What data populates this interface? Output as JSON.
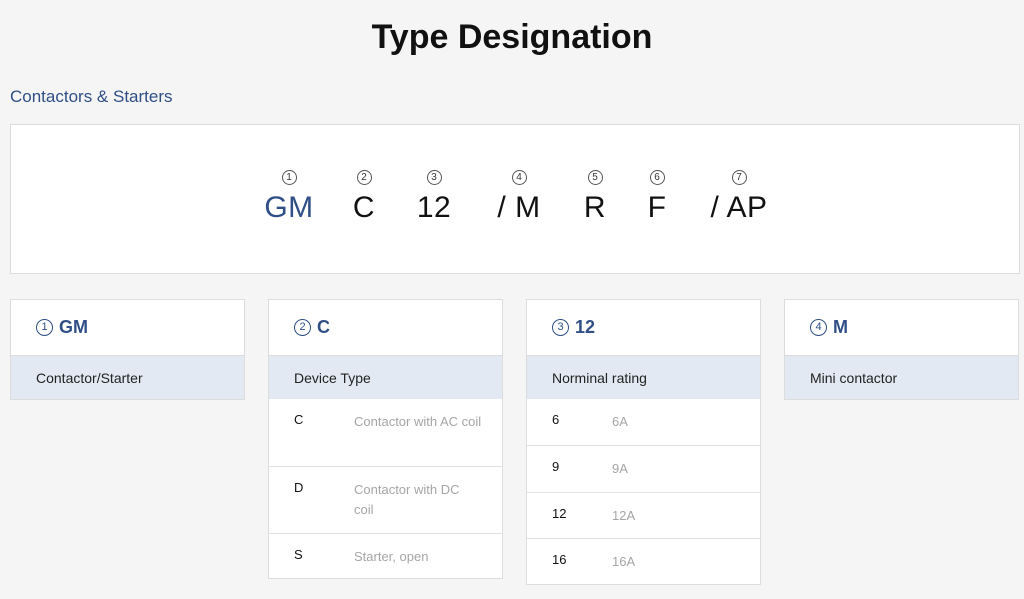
{
  "page": {
    "title": "Type Designation",
    "section": "Contactors & Starters"
  },
  "designation": [
    {
      "num": "1",
      "code": "GM"
    },
    {
      "num": "2",
      "code": "C"
    },
    {
      "num": "3",
      "code": "12"
    },
    {
      "num": "4",
      "code": "/ M"
    },
    {
      "num": "5",
      "code": "R"
    },
    {
      "num": "6",
      "code": "F"
    },
    {
      "num": "7",
      "code": "/ AP"
    }
  ],
  "cards": [
    {
      "num": "1",
      "code": "GM",
      "subtitle": "Contactor/Starter",
      "options": []
    },
    {
      "num": "2",
      "code": "C",
      "subtitle": "Device Type",
      "options": [
        {
          "code": "C",
          "desc": "Contactor with AC coil"
        },
        {
          "code": "D",
          "desc": "Contactor with DC coil"
        },
        {
          "code": "S",
          "desc": "Starter, open"
        }
      ]
    },
    {
      "num": "3",
      "code": "12",
      "subtitle": "Norminal rating",
      "options": [
        {
          "code": "6",
          "desc": "6A"
        },
        {
          "code": "9",
          "desc": "9A"
        },
        {
          "code": "12",
          "desc": "12A"
        },
        {
          "code": "16",
          "desc": "16A"
        }
      ]
    },
    {
      "num": "4",
      "code": "M",
      "subtitle": "Mini contactor",
      "options": []
    }
  ],
  "colors": {
    "accent": "#2f4f86",
    "subheader_bg": "#e3e9f2",
    "muted_text": "#a5a5a5"
  }
}
